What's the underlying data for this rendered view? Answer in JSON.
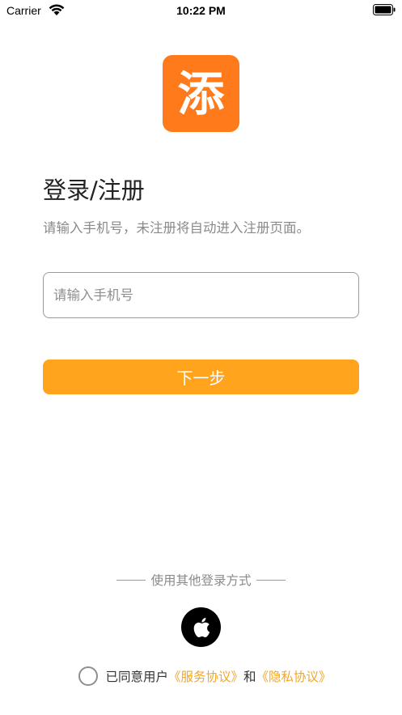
{
  "status_bar": {
    "carrier": "Carrier",
    "time": "10:22 PM"
  },
  "logo": {
    "glyph": "添",
    "color": "#ff7a1a"
  },
  "header": {
    "title": "登录/注册",
    "subtitle": "请输入手机号，未注册将自动进入注册页面。"
  },
  "form": {
    "phone_placeholder": "请输入手机号",
    "phone_value": "",
    "next_label": "下一步",
    "next_color": "#ffa41c"
  },
  "other_login": {
    "label": "使用其他登录方式",
    "methods": [
      {
        "name": "apple",
        "icon": "apple-icon"
      }
    ]
  },
  "agreement": {
    "prefix": "已同意用户",
    "service_link": "《服务协议》",
    "connector": "和",
    "privacy_link": "《隐私协议》",
    "checked": false,
    "link_color": "#f5a623"
  }
}
